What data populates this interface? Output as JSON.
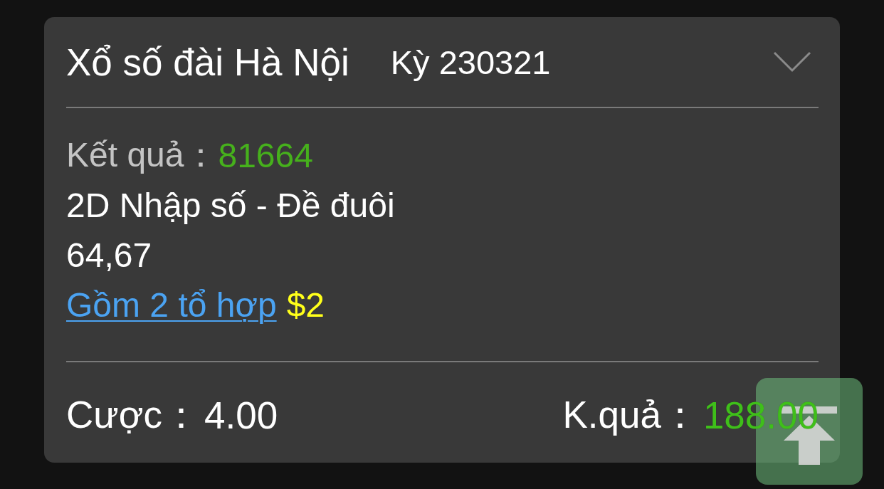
{
  "header": {
    "title": "Xổ số đài Hà Nội",
    "period": "Kỳ 230321"
  },
  "result": {
    "label": "Kết quả：",
    "value": "81664"
  },
  "bet_type": "2D Nhập số - Đề đuôi",
  "numbers": "64,67",
  "combinations": {
    "link": "Gồm 2 tổ hợp",
    "amount": "$2"
  },
  "summary": [
    {
      "kind": "stake",
      "label": "Cược：",
      "value": "4.00"
    },
    {
      "kind": "payout",
      "label": "K.quả：",
      "value": "188.00"
    }
  ]
}
